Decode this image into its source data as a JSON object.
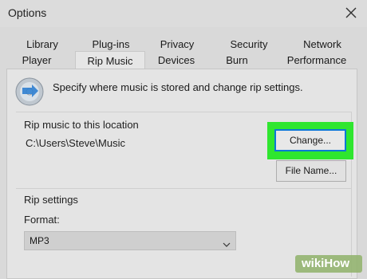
{
  "window": {
    "title": "Options"
  },
  "tabs_row1": [
    "Library",
    "Plug-ins",
    "Privacy",
    "Security",
    "Network"
  ],
  "tabs_row2": [
    "Player",
    "Rip Music",
    "Devices",
    "Burn",
    "Performance"
  ],
  "active_tab": "Rip Music",
  "description": "Specify where music is stored and change rip settings.",
  "rip_location": {
    "group_label": "Rip music to this location",
    "path": "C:\\Users\\Steve\\Music",
    "change_button": "Change...",
    "file_name_button": "File Name..."
  },
  "rip_settings": {
    "group_label": "Rip settings",
    "format_label": "Format:",
    "format_value": "MP3"
  },
  "icons": {
    "close": "close-icon",
    "disc": "cd-disc-icon",
    "dropdown": "chevron-down-icon"
  },
  "colors": {
    "highlight": "#2fe62f",
    "focus_border": "#0b78d7"
  },
  "watermark": {
    "prefix": "wiki",
    "suffix": "How"
  }
}
